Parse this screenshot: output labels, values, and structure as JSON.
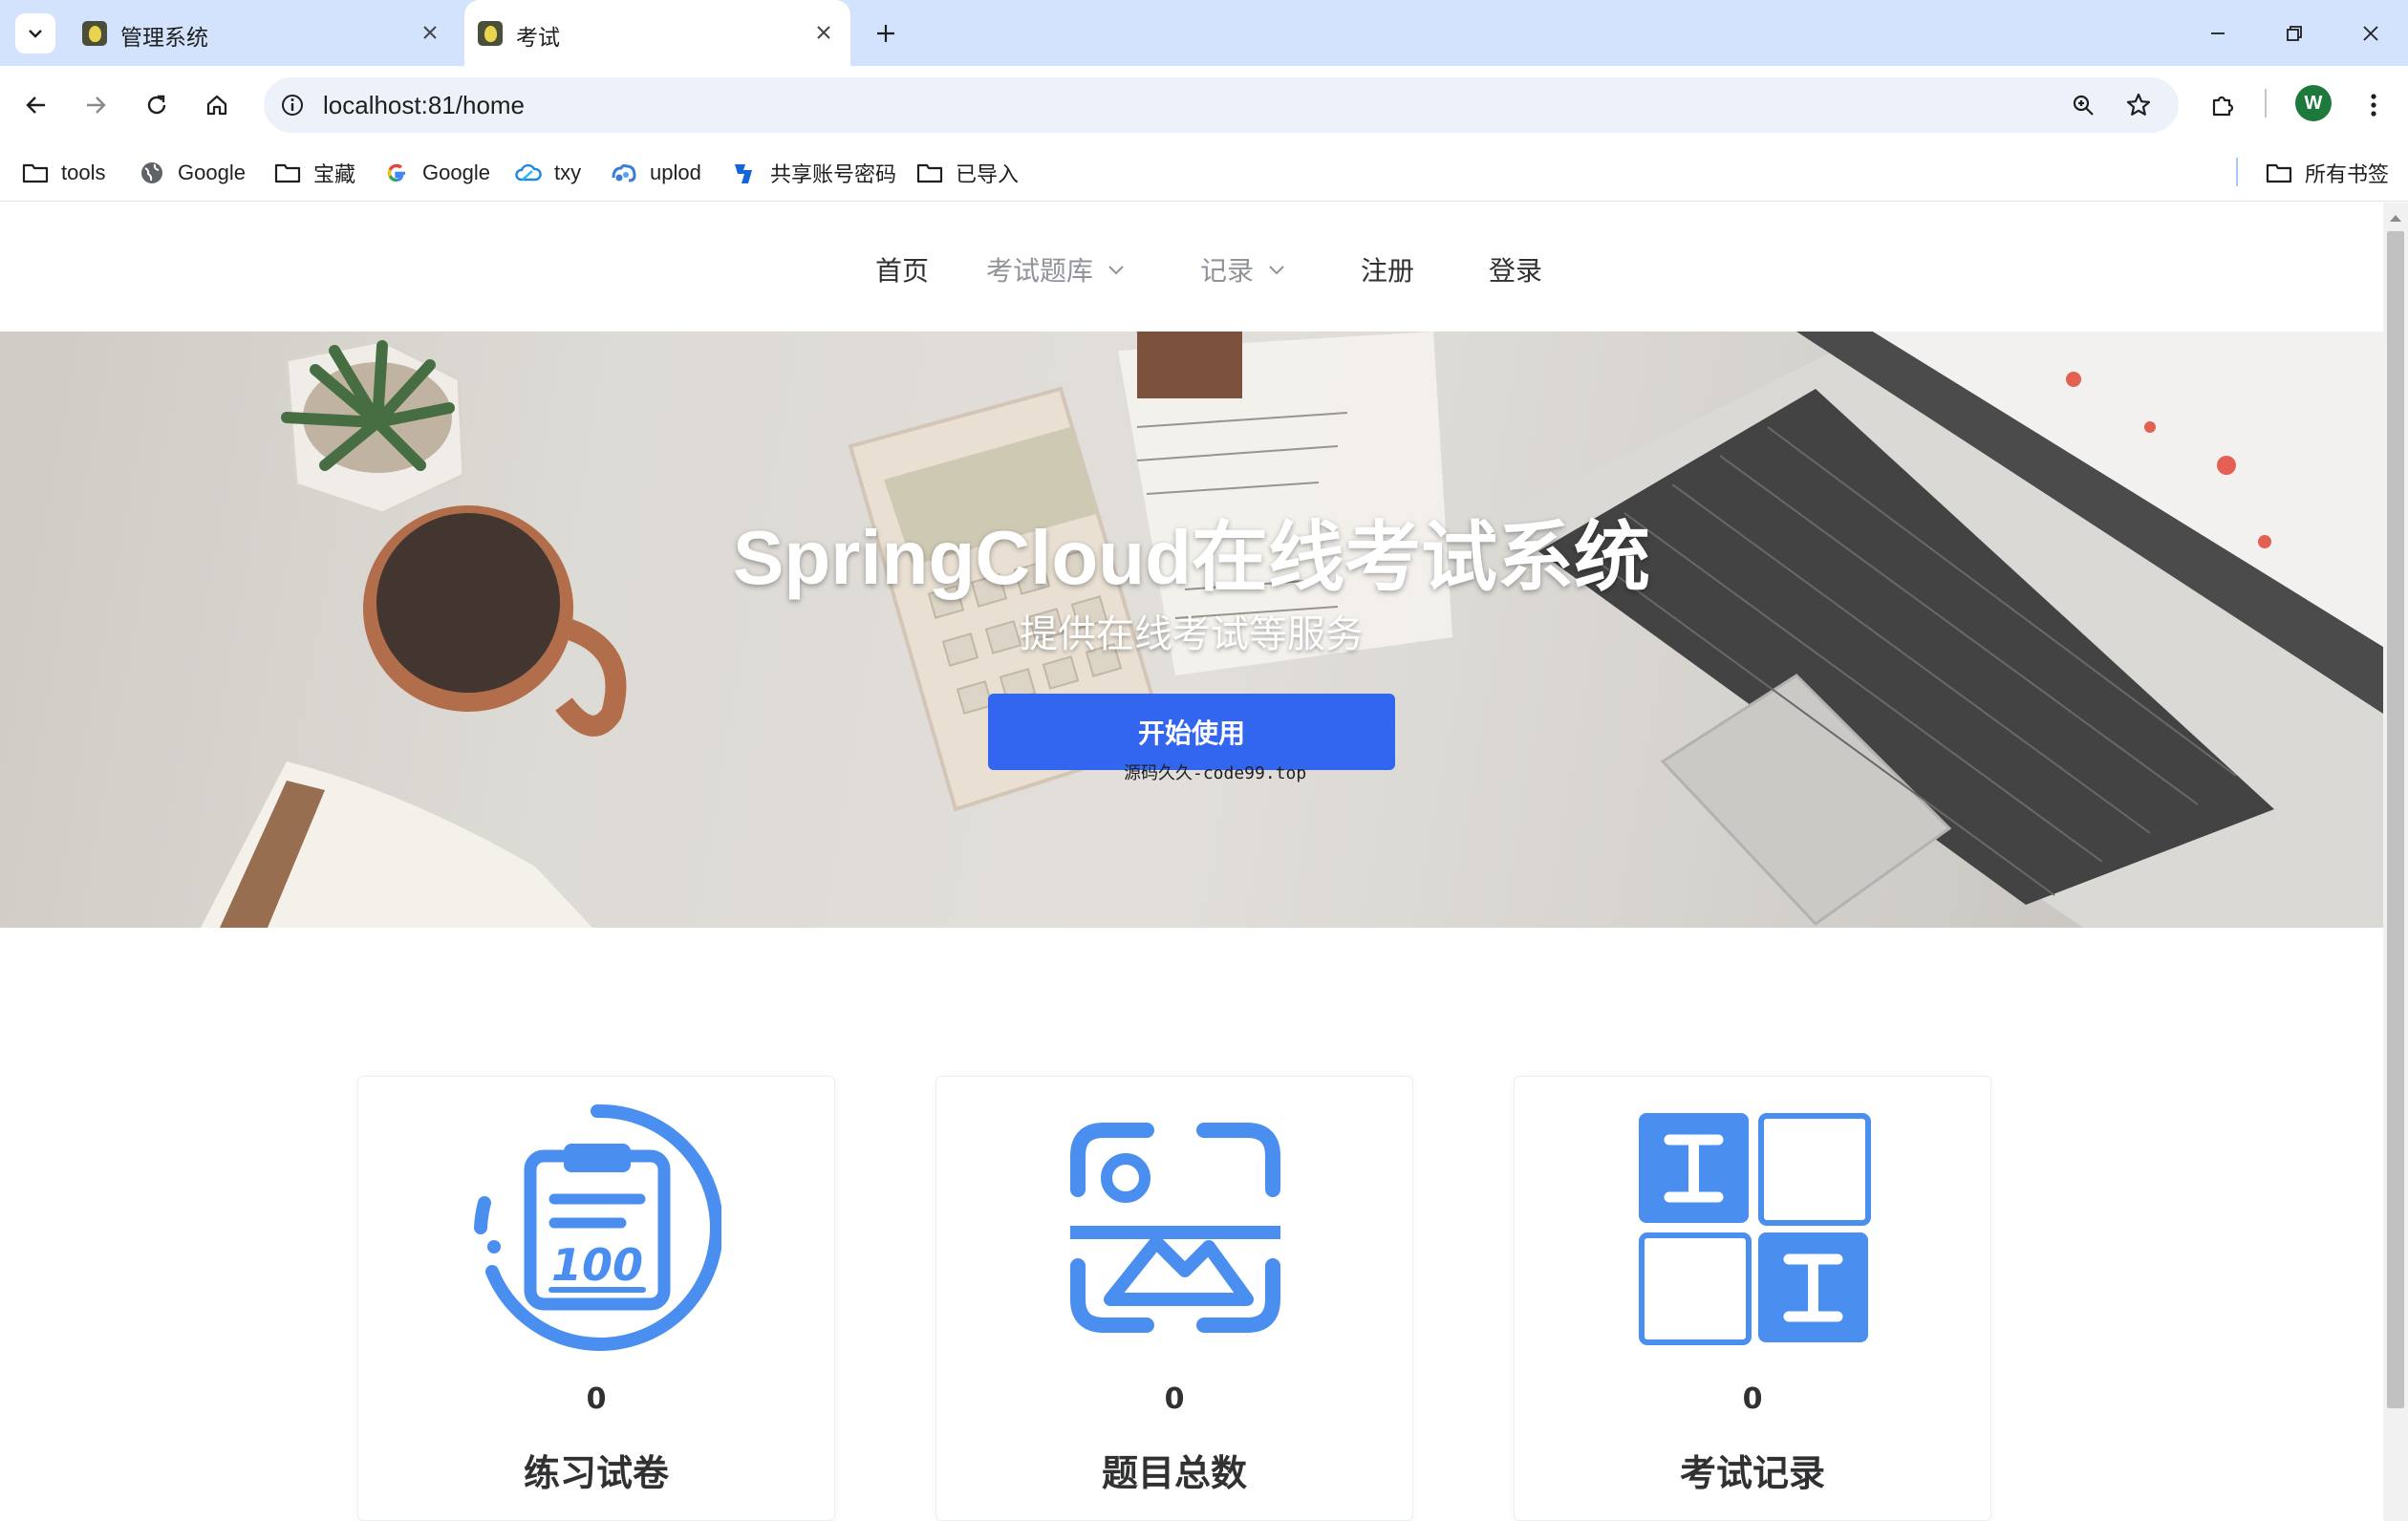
{
  "browser": {
    "tabs": [
      {
        "title": "管理系统",
        "active": false
      },
      {
        "title": "考试",
        "active": true
      }
    ],
    "url": "localhost:81/home",
    "profile_initial": "W",
    "bookmarks": [
      {
        "label": "tools",
        "icon": "folder-icon"
      },
      {
        "label": "Google",
        "icon": "globe-icon"
      },
      {
        "label": "宝藏",
        "icon": "folder-icon"
      },
      {
        "label": "Google",
        "icon": "google-icon"
      },
      {
        "label": "txy",
        "icon": "cloud-icon"
      },
      {
        "label": "uplod",
        "icon": "upload-logo-icon"
      },
      {
        "label": "共享账号密码",
        "icon": "share-logo-icon"
      },
      {
        "label": "已导入",
        "icon": "folder-icon"
      }
    ],
    "all_bookmarks_label": "所有书签",
    "accent_color": "#d3e3fd"
  },
  "site": {
    "nav": {
      "home": "首页",
      "question_bank": "考试题库",
      "records": "记录",
      "register": "注册",
      "login": "登录"
    },
    "hero": {
      "title": "SpringCloud在线考试系统",
      "subtitle": "提供在线考试等服务",
      "button": "开始使用",
      "note": "源码久久-code99.top"
    },
    "stats": [
      {
        "count": "0",
        "label": "练习试卷",
        "icon": "clipboard-score-icon"
      },
      {
        "count": "0",
        "label": "题目总数",
        "icon": "image-scan-icon"
      },
      {
        "count": "0",
        "label": "考试记录",
        "icon": "grid-text-icon"
      }
    ],
    "brand_color": "#3366ee",
    "icon_color": "#4a8ef0"
  }
}
